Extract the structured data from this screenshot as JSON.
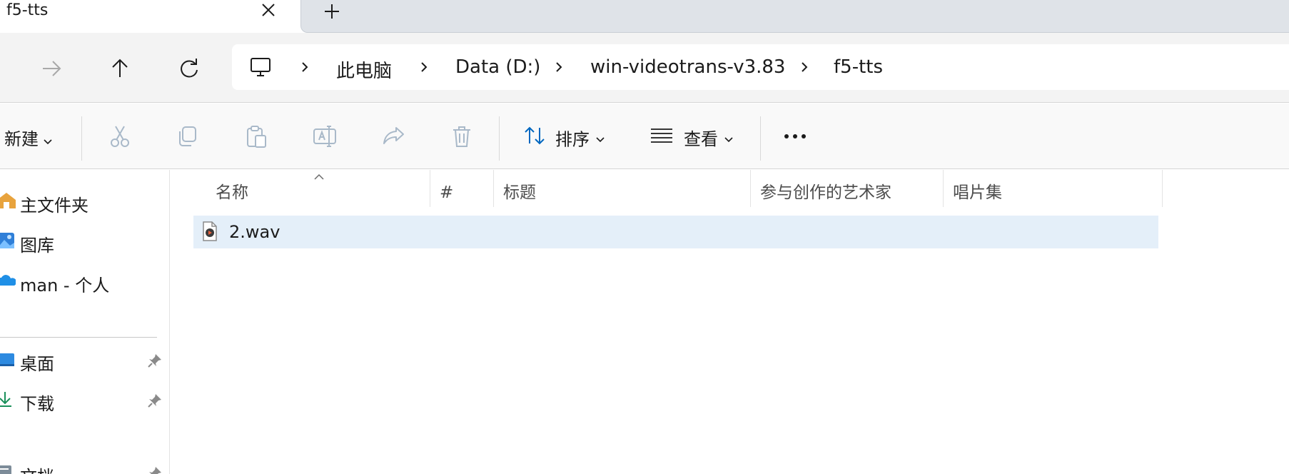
{
  "tab": {
    "title": "f5-tts"
  },
  "breadcrumb": {
    "items": [
      "此电脑",
      "Data (D:)",
      "win-videotrans-v3.83",
      "f5-tts"
    ]
  },
  "commandbar": {
    "new_label": "新建",
    "sort_label": "排序",
    "view_label": "查看"
  },
  "sidebar": {
    "items": [
      {
        "label": "主文件夹",
        "icon": "home-icon"
      },
      {
        "label": "图库",
        "icon": "gallery-icon"
      },
      {
        "label": "man - 个人",
        "icon": "onedrive-cloud-icon"
      }
    ],
    "pinned": [
      {
        "label": "桌面",
        "icon": "desktop-icon"
      },
      {
        "label": "下载",
        "icon": "download-icon"
      },
      {
        "label": "文档",
        "icon": "documents-icon"
      }
    ]
  },
  "filelist": {
    "columns": [
      "名称",
      "#",
      "标题",
      "参与创作的艺术家",
      "唱片集"
    ],
    "rows": [
      {
        "name": "2.wav",
        "selected": true
      }
    ]
  },
  "colors": {
    "selection": "#e4eff9",
    "accent": "#0067c0",
    "folder_desktop": "#2d8ae0",
    "download_green": "#1a8f5a"
  }
}
